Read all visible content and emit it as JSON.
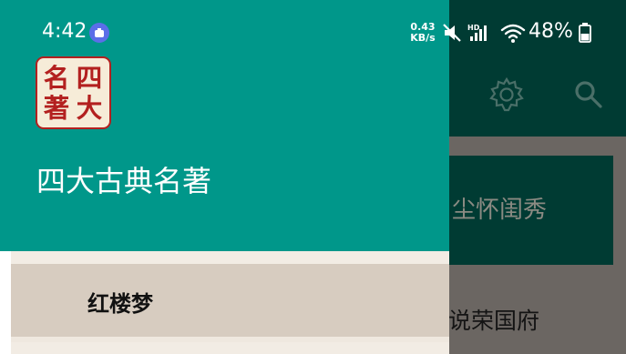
{
  "status_bar": {
    "time": "4:42",
    "net_speed_value": "0.43",
    "net_speed_unit": "KB/s",
    "signal_tag": "HD",
    "battery": "48%",
    "icons": [
      "notification-icon",
      "mute-icon",
      "signal-icon",
      "wifi-icon",
      "battery-icon"
    ]
  },
  "drawer": {
    "logo_chars": [
      "名",
      "四",
      "著",
      "大"
    ],
    "app_name": "四大古典名著",
    "menu": [
      {
        "label": "红楼梦",
        "selected": true
      }
    ]
  },
  "background": {
    "toolbar_icons": [
      "settings-icon",
      "search-icon"
    ],
    "card_text": "尘怀闺秀",
    "item_text": "说荣国府"
  },
  "colors": {
    "primary": "#00978a",
    "primary_dark_dimmed": "#003b33",
    "menu_selected": "#d7ccc0",
    "logo_red": "#b3201f"
  }
}
